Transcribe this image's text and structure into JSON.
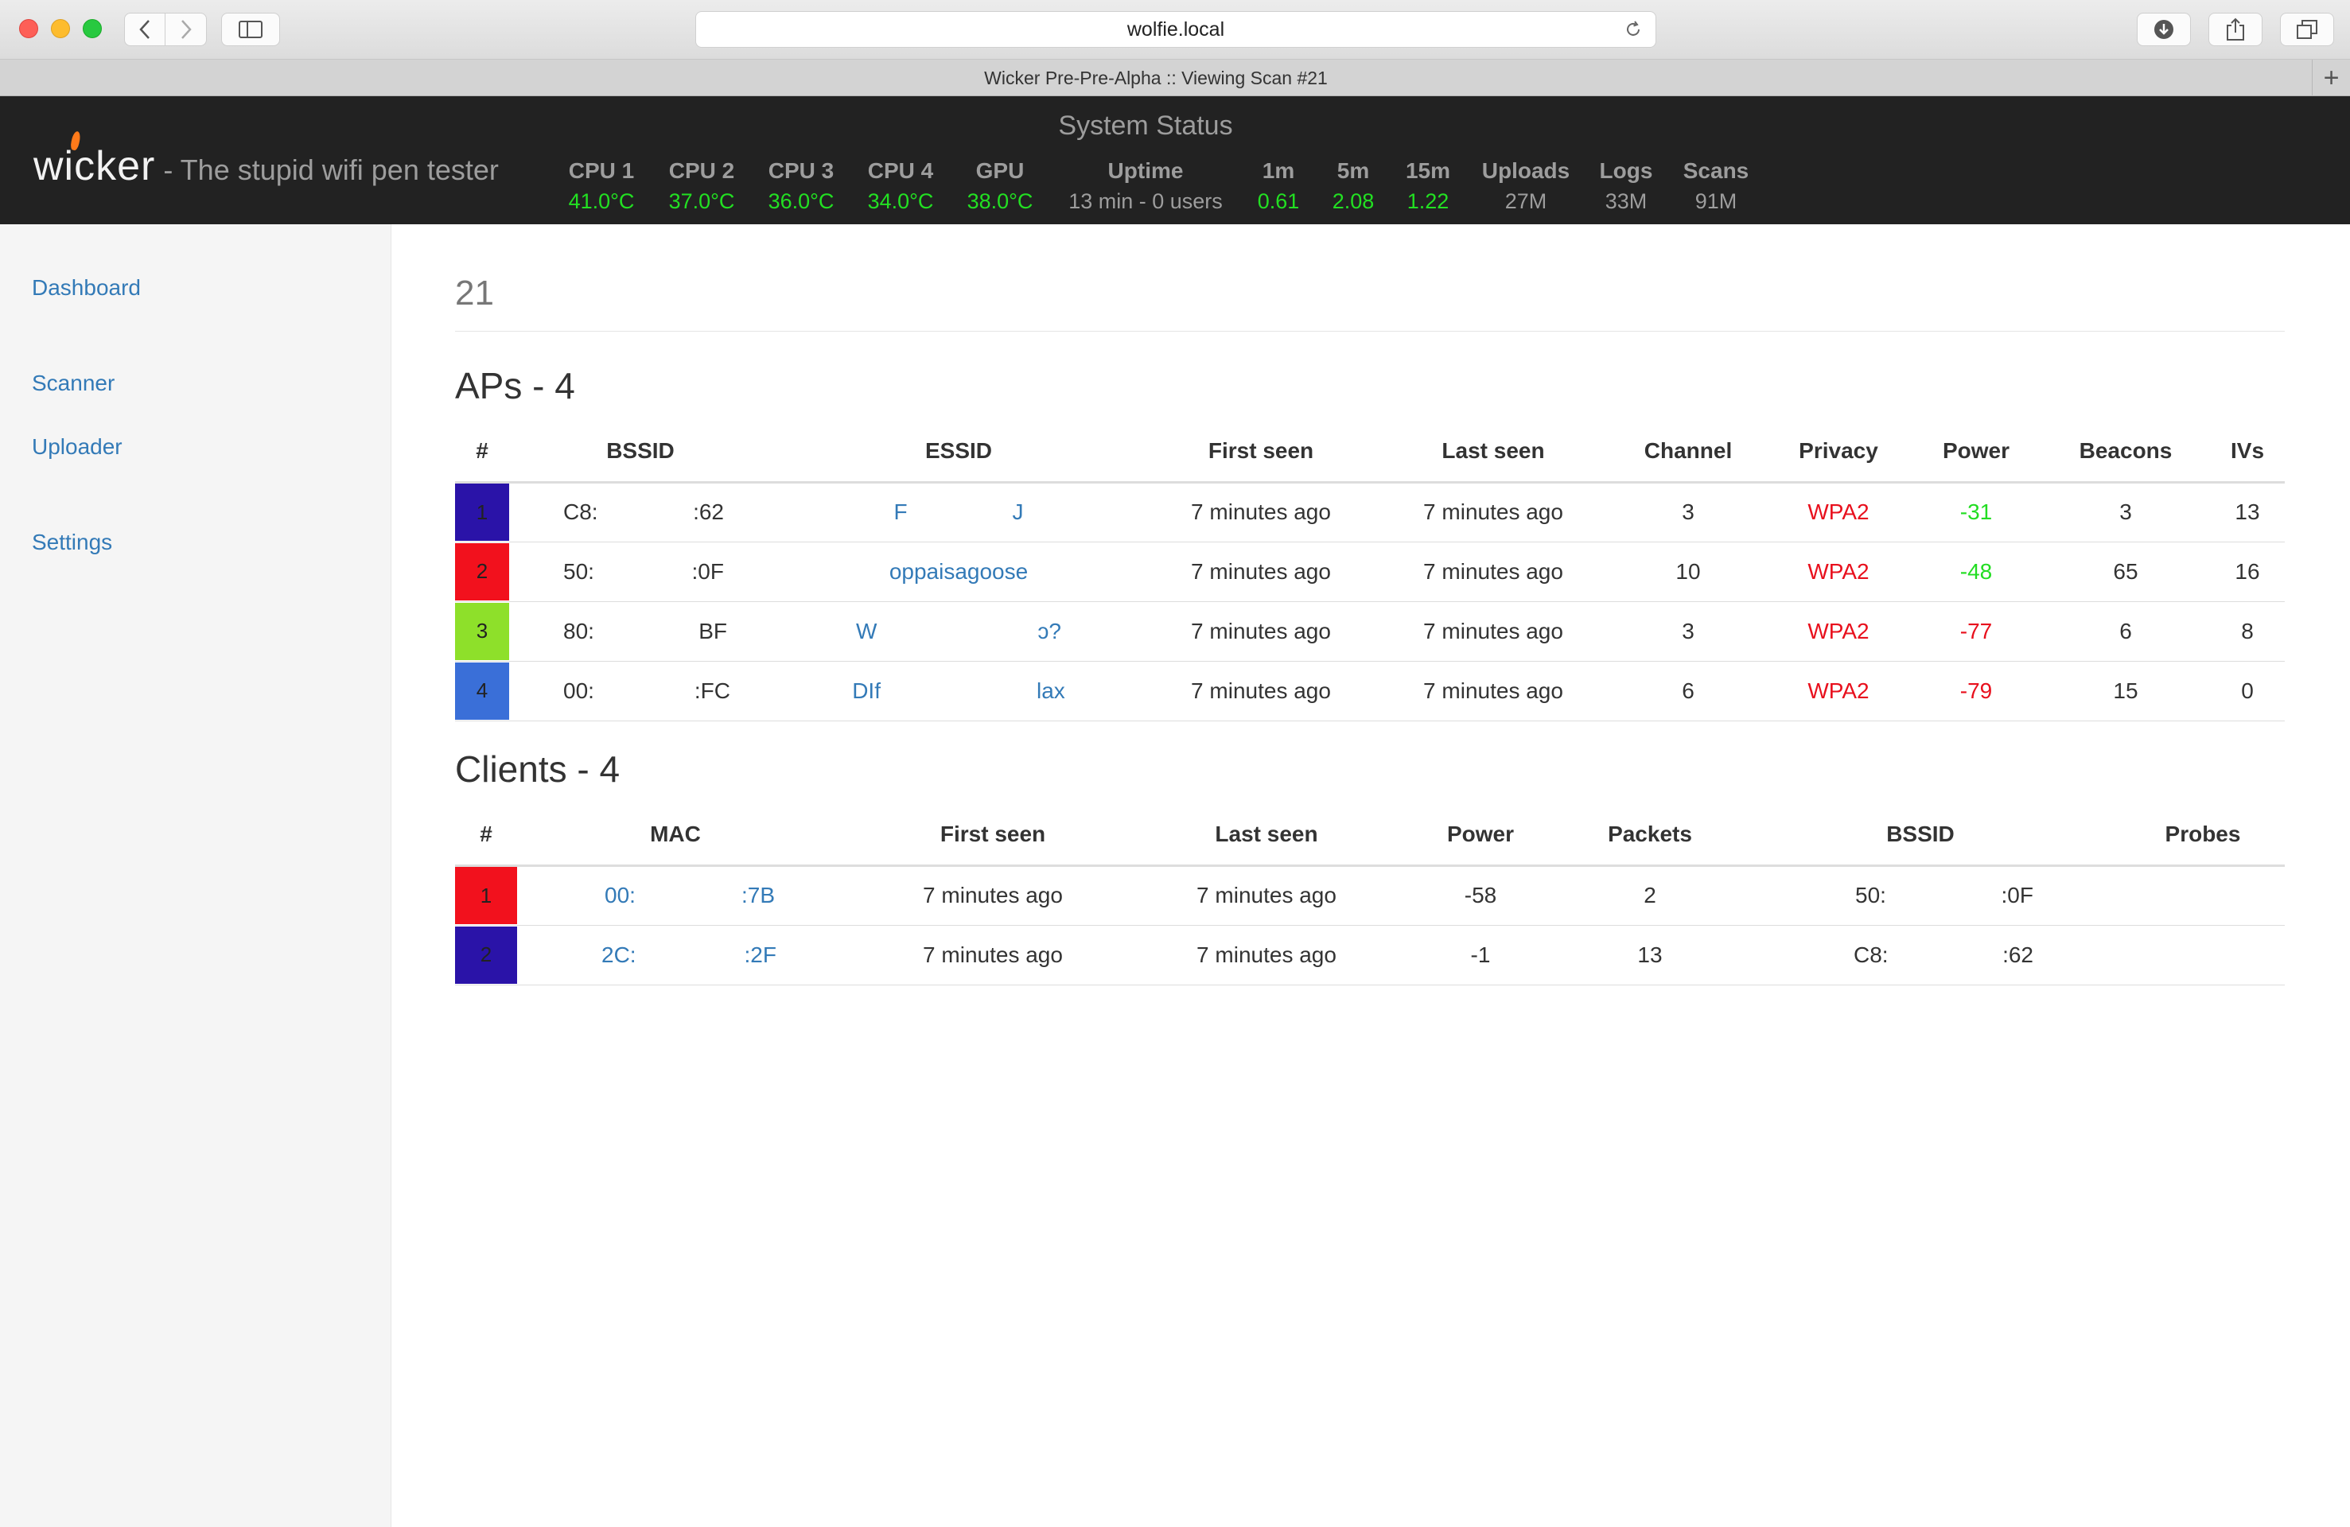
{
  "browser": {
    "url": "wolfie.local",
    "tab_title": "Wicker Pre-Pre-Alpha :: Viewing Scan #21",
    "new_tab_label": "+"
  },
  "header": {
    "brand": "wicker",
    "tagline": "- The stupid wifi pen tester",
    "status_title": "System Status",
    "stats": [
      {
        "label": "CPU 1",
        "value": "41.0°C",
        "color": "#22e022"
      },
      {
        "label": "CPU 2",
        "value": "37.0°C",
        "color": "#22e022"
      },
      {
        "label": "CPU 3",
        "value": "36.0°C",
        "color": "#22e022"
      },
      {
        "label": "CPU 4",
        "value": "34.0°C",
        "color": "#22e022"
      },
      {
        "label": "GPU",
        "value": "38.0°C",
        "color": "#22e022"
      },
      {
        "label": "Uptime",
        "value": "13 min - 0 users",
        "color": "#9d9d9d"
      },
      {
        "label": "1m",
        "value": "0.61",
        "color": "#22e022"
      },
      {
        "label": "5m",
        "value": "2.08",
        "color": "#22e022"
      },
      {
        "label": "15m",
        "value": "1.22",
        "color": "#22e022"
      },
      {
        "label": "Uploads",
        "value": "27M",
        "color": "#9d9d9d"
      },
      {
        "label": "Logs",
        "value": "33M",
        "color": "#9d9d9d"
      },
      {
        "label": "Scans",
        "value": "91M",
        "color": "#9d9d9d"
      }
    ]
  },
  "sidebar": {
    "items": [
      {
        "label": "Dashboard"
      },
      {
        "label": "Scanner"
      },
      {
        "label": "Uploader"
      },
      {
        "label": "Settings"
      }
    ]
  },
  "main": {
    "page_title": "21",
    "aps": {
      "title": "APs - 4",
      "columns": [
        "#",
        "BSSID",
        "ESSID",
        "First seen",
        "Last seen",
        "Channel",
        "Privacy",
        "Power",
        "Beacons",
        "IVs"
      ],
      "rows": [
        {
          "num": "1",
          "color": "#2a13a8",
          "bssid_a": "C8:",
          "bssid_b": ":62",
          "essid_a": "F",
          "essid_b": "J",
          "first_seen": "7 minutes ago",
          "last_seen": "7 minutes ago",
          "channel": "3",
          "privacy": "WPA2",
          "power": "-31",
          "power_good": true,
          "beacons": "3",
          "ivs": "13"
        },
        {
          "num": "2",
          "color": "#f2111d",
          "bssid_a": "50:",
          "bssid_b": ":0F",
          "essid_a": "oppaisagoose",
          "essid_b": "",
          "first_seen": "7 minutes ago",
          "last_seen": "7 minutes ago",
          "channel": "10",
          "privacy": "WPA2",
          "power": "-48",
          "power_good": true,
          "beacons": "65",
          "ivs": "16"
        },
        {
          "num": "3",
          "color": "#8ee02a",
          "bssid_a": "80:",
          "bssid_b": "BF",
          "essid_a": "W",
          "essid_b": "ɔ?",
          "first_seen": "7 minutes ago",
          "last_seen": "7 minutes ago",
          "channel": "3",
          "privacy": "WPA2",
          "power": "-77",
          "power_good": false,
          "beacons": "6",
          "ivs": "8"
        },
        {
          "num": "4",
          "color": "#3a6fd8",
          "bssid_a": "00:",
          "bssid_b": ":FC",
          "essid_a": "DIf",
          "essid_b": "lax",
          "first_seen": "7 minutes ago",
          "last_seen": "7 minutes ago",
          "channel": "6",
          "privacy": "WPA2",
          "power": "-79",
          "power_good": false,
          "beacons": "15",
          "ivs": "0"
        }
      ]
    },
    "clients": {
      "title": "Clients - 4",
      "columns": [
        "#",
        "MAC",
        "First seen",
        "Last seen",
        "Power",
        "Packets",
        "BSSID",
        "Probes"
      ],
      "rows": [
        {
          "num": "1",
          "color": "#f2111d",
          "mac_a": "00:",
          "mac_b": ":7B",
          "first_seen": "7 minutes ago",
          "last_seen": "7 minutes ago",
          "power": "-58",
          "packets": "2",
          "bssid_a": "50:",
          "bssid_b": ":0F",
          "probes": ""
        },
        {
          "num": "2",
          "color": "#2a13a8",
          "mac_a": "2C:",
          "mac_b": ":2F",
          "first_seen": "7 minutes ago",
          "last_seen": "7 minutes ago",
          "power": "-1",
          "packets": "13",
          "bssid_a": "C8:",
          "bssid_b": ":62",
          "probes": ""
        }
      ]
    }
  }
}
